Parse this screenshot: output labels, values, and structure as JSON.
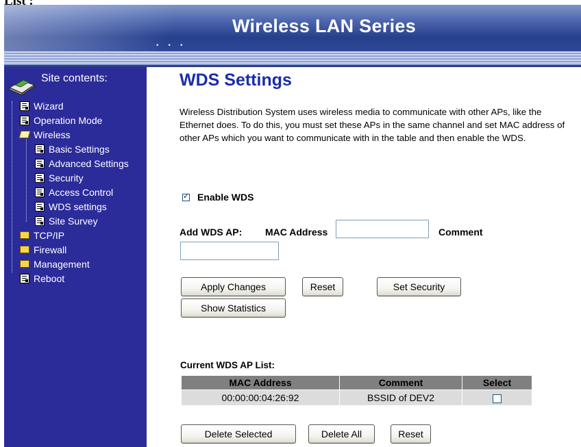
{
  "header": {
    "fragment_text": "List :",
    "title": "Wireless LAN Series"
  },
  "sidebar": {
    "heading": "Site contents:",
    "items": [
      {
        "label": "Wizard",
        "level": 1,
        "icon": "document-icon"
      },
      {
        "label": "Operation Mode",
        "level": 1,
        "icon": "document-icon"
      },
      {
        "label": "Wireless",
        "level": 1,
        "icon": "folder-open-icon"
      },
      {
        "label": "Basic Settings",
        "level": 2,
        "icon": "document-icon"
      },
      {
        "label": "Advanced Settings",
        "level": 2,
        "icon": "document-icon"
      },
      {
        "label": "Security",
        "level": 2,
        "icon": "document-icon"
      },
      {
        "label": "Access Control",
        "level": 2,
        "icon": "document-icon"
      },
      {
        "label": "WDS settings",
        "level": 2,
        "icon": "document-icon"
      },
      {
        "label": "Site Survey",
        "level": 2,
        "icon": "document-icon"
      },
      {
        "label": "TCP/IP",
        "level": 1,
        "icon": "folder-icon"
      },
      {
        "label": "Firewall",
        "level": 1,
        "icon": "folder-icon"
      },
      {
        "label": "Management",
        "level": 1,
        "icon": "folder-icon"
      },
      {
        "label": "Reboot",
        "level": 1,
        "icon": "document-icon"
      }
    ]
  },
  "main": {
    "title": "WDS Settings",
    "description": "Wireless Distribution System uses wireless media to communicate with other APs, like the Ethernet does. To do this, you must set these APs in the same channel and set MAC address of other APs which you want to communicate with in the table and then enable the WDS.",
    "enable_label": "Enable WDS",
    "enable_checked": true,
    "add_label": "Add WDS AP:",
    "mac_label": "MAC Address",
    "mac_value": "",
    "comment_label": "Comment",
    "comment_value": "",
    "buttons": {
      "apply": "Apply Changes",
      "reset": "Reset",
      "set_security": "Set Security",
      "show_statistics": "Show Statistics"
    },
    "list": {
      "heading": "Current WDS AP List:",
      "columns": [
        "MAC Address",
        "Comment",
        "Select"
      ],
      "rows": [
        {
          "mac": "00:00:00:04:26:92",
          "comment": "BSSID of DEV2",
          "selected": false
        }
      ]
    },
    "list_buttons": {
      "delete_selected": "Delete Selected",
      "delete_all": "Delete All",
      "reset": "Reset"
    }
  },
  "colors": {
    "sidebar_bg": "#2c2b9a",
    "title_color": "#1b2dab",
    "banner_dark": "#27408c"
  }
}
